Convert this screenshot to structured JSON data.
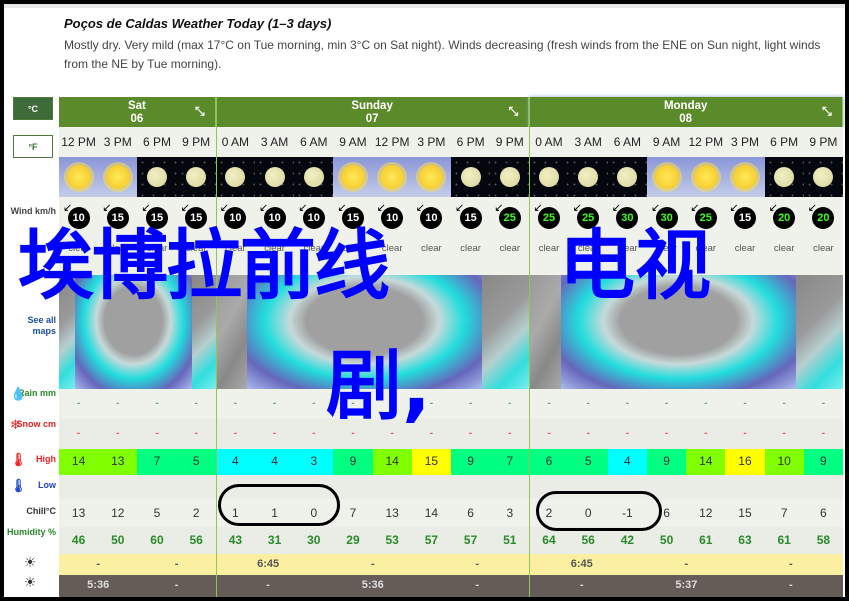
{
  "page": {
    "title": "Poços de Caldas Weather Today (1–3 days)",
    "summary": "Mostly dry. Very mild (max 17°C on Tue morning, min 3°C on Sat night). Winds decreasing (fresh winds from the ENE on Sun night, light winds from the NE by Tue morning)."
  },
  "units": {
    "celsius": "°C",
    "fahrenheit": "°F"
  },
  "row_labels": {
    "wind": "Wind km/h",
    "maps": "See all maps",
    "rain": "Rain mm",
    "snow": "Snow cm",
    "high": "High",
    "low": "Low",
    "chill": "Chill°C",
    "humidity": "Humidity %"
  },
  "days": [
    {
      "name": "Sat",
      "date": "06",
      "collapse_icon": "collapse-icon"
    },
    {
      "name": "Sunday",
      "date": "07",
      "collapse_icon": "collapse-icon"
    },
    {
      "name": "Monday",
      "date": "08",
      "collapse_icon": "collapse-icon"
    }
  ],
  "periods": [
    {
      "day": 0,
      "time": "12 PM",
      "sky": "sun",
      "wind": "10",
      "wind_color": "white",
      "desc": "clear",
      "rain": "-",
      "snow": "-",
      "high": "14",
      "high_color": "#80ff00",
      "chill": "13",
      "humidity": "46"
    },
    {
      "day": 0,
      "time": "3 PM",
      "sky": "sun",
      "wind": "15",
      "wind_color": "white",
      "desc": "clear",
      "rain": "-",
      "snow": "-",
      "high": "13",
      "high_color": "#80ff00",
      "chill": "12",
      "humidity": "50"
    },
    {
      "day": 0,
      "time": "6 PM",
      "sky": "moon",
      "wind": "15",
      "wind_color": "white",
      "desc": "clear",
      "rain": "-",
      "snow": "-",
      "high": "7",
      "high_color": "#00ff80",
      "chill": "5",
      "humidity": "60"
    },
    {
      "day": 0,
      "time": "9 PM",
      "sky": "moon",
      "wind": "15",
      "wind_color": "white",
      "desc": "clear",
      "rain": "-",
      "snow": "-",
      "high": "5",
      "high_color": "#00ff80",
      "chill": "2",
      "humidity": "56"
    },
    {
      "day": 1,
      "time": "0 AM",
      "sky": "moon",
      "wind": "10",
      "wind_color": "white",
      "desc": "clear",
      "rain": "-",
      "snow": "-",
      "high": "4",
      "high_color": "#00ffff",
      "chill": "1",
      "humidity": "43"
    },
    {
      "day": 1,
      "time": "3 AM",
      "sky": "moon",
      "wind": "10",
      "wind_color": "white",
      "desc": "clear",
      "rain": "-",
      "snow": "-",
      "high": "4",
      "high_color": "#00ffff",
      "chill": "1",
      "humidity": "31"
    },
    {
      "day": 1,
      "time": "6 AM",
      "sky": "moon",
      "wind": "10",
      "wind_color": "white",
      "desc": "clear",
      "rain": "-",
      "snow": "-",
      "high": "3",
      "high_color": "#00ffff",
      "chill": "0",
      "humidity": "30"
    },
    {
      "day": 1,
      "time": "9 AM",
      "sky": "sun",
      "wind": "15",
      "wind_color": "white",
      "desc": "clear",
      "rain": "-",
      "snow": "-",
      "high": "9",
      "high_color": "#00ff80",
      "chill": "7",
      "humidity": "29"
    },
    {
      "day": 1,
      "time": "12 PM",
      "sky": "sun",
      "wind": "10",
      "wind_color": "white",
      "desc": "clear",
      "rain": "-",
      "snow": "-",
      "high": "14",
      "high_color": "#80ff00",
      "chill": "13",
      "humidity": "53"
    },
    {
      "day": 1,
      "time": "3 PM",
      "sky": "sun",
      "wind": "10",
      "wind_color": "white",
      "desc": "clear",
      "rain": "-",
      "snow": "-",
      "high": "15",
      "high_color": "#ffff00",
      "chill": "14",
      "humidity": "57"
    },
    {
      "day": 1,
      "time": "6 PM",
      "sky": "moon",
      "wind": "15",
      "wind_color": "white",
      "desc": "clear",
      "rain": "-",
      "snow": "-",
      "high": "9",
      "high_color": "#00ff80",
      "chill": "6",
      "humidity": "57"
    },
    {
      "day": 1,
      "time": "9 PM",
      "sky": "moon",
      "wind": "25",
      "wind_color": "green",
      "desc": "clear",
      "rain": "-",
      "snow": "-",
      "high": "7",
      "high_color": "#00ff80",
      "chill": "3",
      "humidity": "51"
    },
    {
      "day": 2,
      "time": "0 AM",
      "sky": "moon",
      "wind": "25",
      "wind_color": "green",
      "desc": "clear",
      "rain": "-",
      "snow": "-",
      "high": "6",
      "high_color": "#00ff80",
      "chill": "2",
      "humidity": "64"
    },
    {
      "day": 2,
      "time": "3 AM",
      "sky": "moon",
      "wind": "25",
      "wind_color": "green",
      "desc": "clear",
      "rain": "-",
      "snow": "-",
      "high": "5",
      "high_color": "#00ff80",
      "chill": "0",
      "humidity": "56"
    },
    {
      "day": 2,
      "time": "6 AM",
      "sky": "moon",
      "wind": "30",
      "wind_color": "green",
      "desc": "clear",
      "rain": "-",
      "snow": "-",
      "high": "4",
      "high_color": "#00ffff",
      "chill": "-1",
      "humidity": "42"
    },
    {
      "day": 2,
      "time": "9 AM",
      "sky": "sun",
      "wind": "30",
      "wind_color": "green",
      "desc": "clear",
      "rain": "-",
      "snow": "-",
      "high": "9",
      "high_color": "#00ff80",
      "chill": "6",
      "humidity": "50"
    },
    {
      "day": 2,
      "time": "12 PM",
      "sky": "sun",
      "wind": "25",
      "wind_color": "green",
      "desc": "clear",
      "rain": "-",
      "snow": "-",
      "high": "14",
      "high_color": "#80ff00",
      "chill": "12",
      "humidity": "61"
    },
    {
      "day": 2,
      "time": "3 PM",
      "sky": "sun",
      "wind": "15",
      "wind_color": "white",
      "desc": "clear",
      "rain": "-",
      "snow": "-",
      "high": "16",
      "high_color": "#ffff00",
      "chill": "15",
      "humidity": "63"
    },
    {
      "day": 2,
      "time": "6 PM",
      "sky": "moon",
      "wind": "20",
      "wind_color": "green",
      "desc": "clear",
      "rain": "-",
      "snow": "-",
      "high": "10",
      "high_color": "#80ff00",
      "chill": "7",
      "humidity": "61"
    },
    {
      "day": 2,
      "time": "9 PM",
      "sky": "moon",
      "wind": "20",
      "wind_color": "green",
      "desc": "clear",
      "rain": "-",
      "snow": "-",
      "high": "9",
      "high_color": "#00ff80",
      "chill": "6",
      "humidity": "58"
    }
  ],
  "sunrise": [
    {
      "value": "-"
    },
    {
      "value": "-"
    },
    {
      "value": "6:45"
    },
    {
      "value": "-"
    },
    {
      "value": "-"
    },
    {
      "value": "6:45"
    },
    {
      "value": "-"
    },
    {
      "value": "-"
    }
  ],
  "sunset": [
    {
      "value": "5:36"
    },
    {
      "value": "-"
    },
    {
      "value": "-"
    },
    {
      "value": "5:36"
    },
    {
      "value": "-"
    },
    {
      "value": "-"
    },
    {
      "value": "5:37"
    },
    {
      "value": "-"
    }
  ],
  "overlay_text": {
    "line1": "埃博拉前线",
    "line2": "电视",
    "line3": "剧,"
  }
}
